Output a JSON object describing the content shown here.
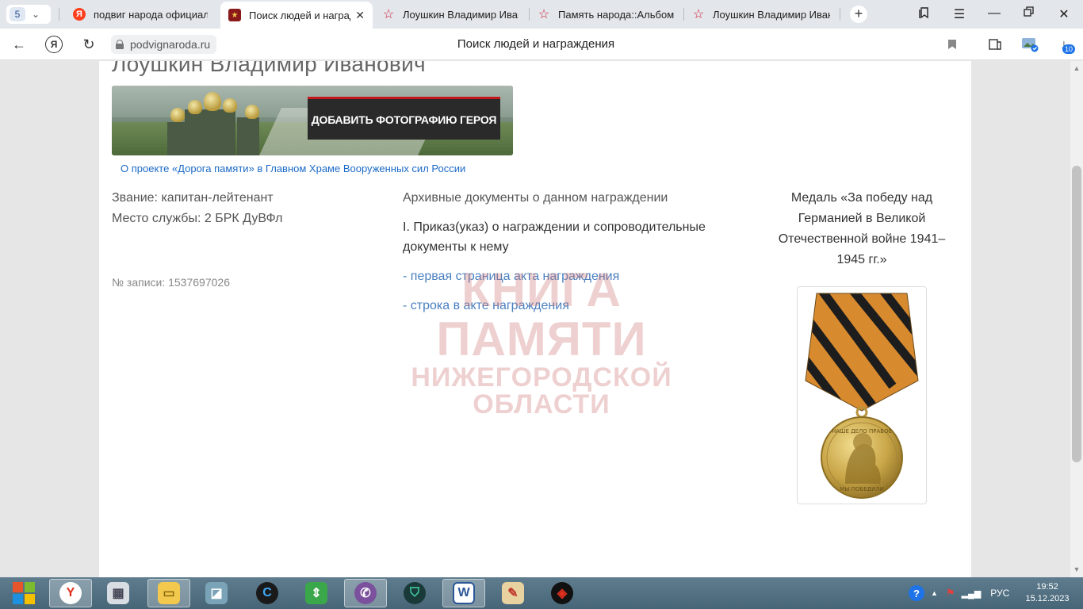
{
  "browser": {
    "tab_count": "5",
    "tabs": [
      {
        "title": "подвиг народа официаль",
        "favicon": "yandex-icon"
      },
      {
        "title": "Поиск людей и наград",
        "favicon": "medal-favicon"
      },
      {
        "title": "Лоушкин Владимир Иван",
        "favicon": "star-icon"
      },
      {
        "title": "Память народа::Альбом у",
        "favicon": "star-icon"
      },
      {
        "title": "Лоушкин Владимир Иван",
        "favicon": "star-icon"
      }
    ],
    "url_domain": "podvignaroda.ru",
    "page_heading": "Поиск людей и награждения",
    "downloads_count": "10"
  },
  "page": {
    "hero_name": "Лоушкин Владимир Иванович",
    "banner_cta": "ДОБАВИТЬ ФОТОГРАФИЮ ГЕРОЯ",
    "project_link": "О проекте «Дорога памяти» в Главном Храме Вооруженных сил России",
    "rank": "Звание: капитан-лейтенант",
    "service_place": "Место службы: 2 БРК ДуВФл",
    "record_no": "№ записи: 1537697026",
    "docs_title": "Архивные документы о данном награждении",
    "docs_order": "I. Приказ(указ) о награждении и сопроводительные документы к нему",
    "docs_link_1": "- первая страница акта награждения",
    "docs_link_2": "- строка в акте награждения",
    "medal_title": "Медаль «За победу над Германией в Великой Отечественной войне 1941–1945 гг.»",
    "medal_inscription_top": "НАШЕ ДЕЛО ПРАВОЕ",
    "medal_inscription_bottom": "МЫ ПОБЕДИЛИ"
  },
  "watermark": {
    "line1": "КНИГА ПАМЯТИ",
    "line2": "НИЖЕГОРОДСКОЙ ОБЛАСТИ"
  },
  "taskbar": {
    "language": "РУС",
    "time": "19:52",
    "date": "15.12.2023"
  },
  "colors": {
    "link": "#1c6ac8",
    "docs_link": "#4a80c0",
    "cta_accent": "#c4161c",
    "watermark": "#cd7878"
  }
}
